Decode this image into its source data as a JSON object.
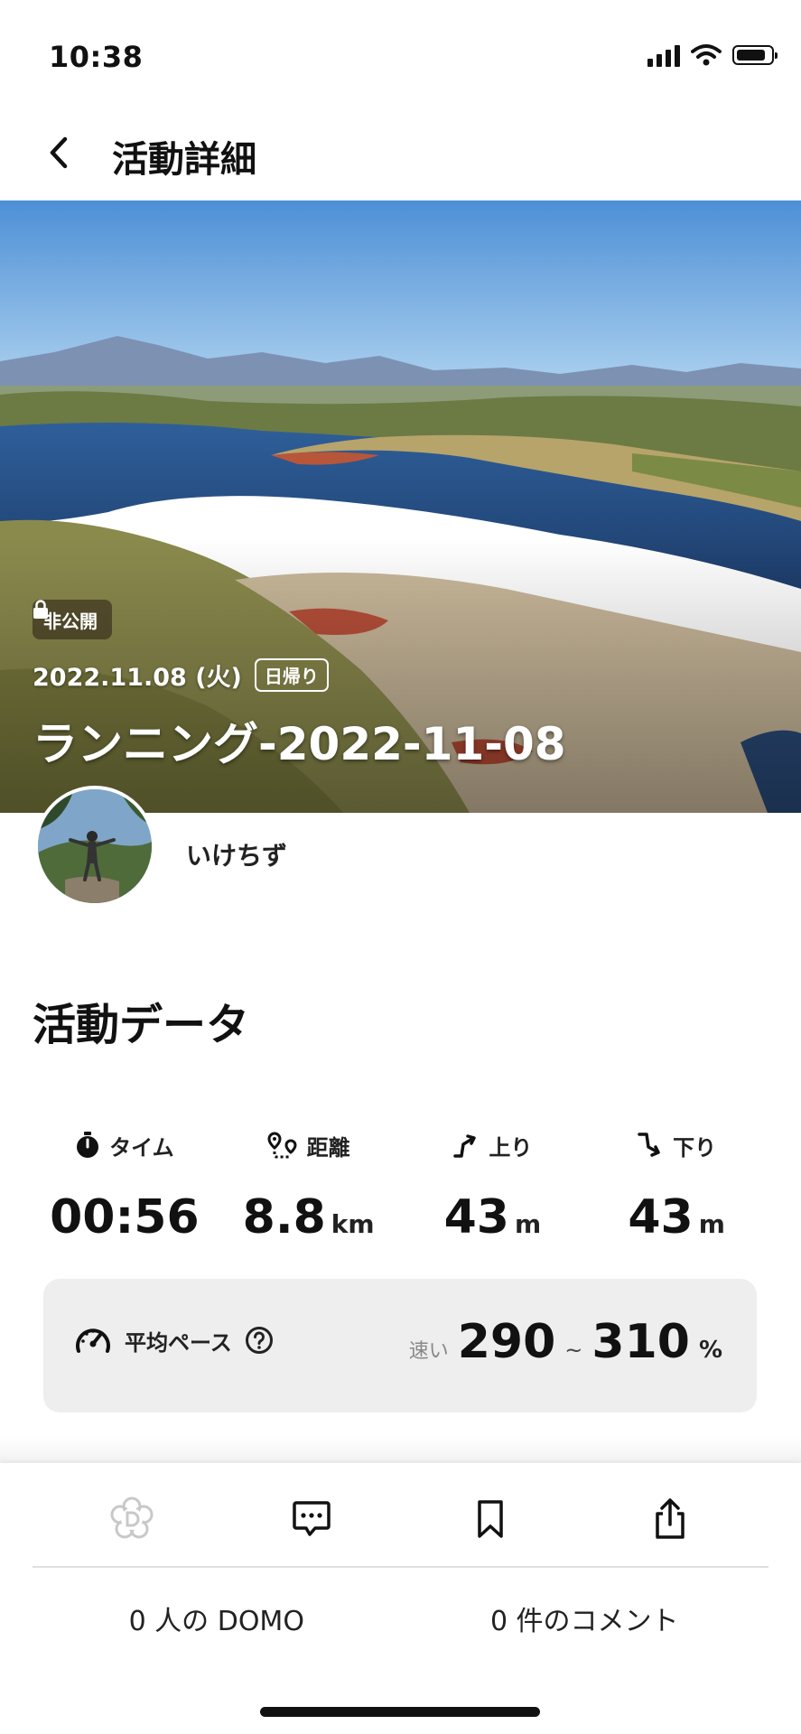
{
  "status_bar": {
    "time": "10:38",
    "icons": [
      "signal-icon",
      "wifi-icon",
      "battery-icon"
    ]
  },
  "nav": {
    "back_icon": "chevron-left-icon",
    "title": "活動詳細"
  },
  "hero": {
    "privacy_label": "非公開",
    "privacy_icon": "lock-icon",
    "date": "2022.11.08 (火)",
    "trip_type": "日帰り",
    "activity_title": "ランニング-2022-11-08"
  },
  "user": {
    "name": "いけちず"
  },
  "activity_data": {
    "section_title": "活動データ",
    "stats": [
      {
        "icon": "stopwatch-icon",
        "label": "タイム",
        "value": "00:56",
        "unit": ""
      },
      {
        "icon": "route-distance-icon",
        "label": "距離",
        "value": "8.8",
        "unit": "km"
      },
      {
        "icon": "ascent-icon",
        "label": "上り",
        "value": "43",
        "unit": "m"
      },
      {
        "icon": "descent-icon",
        "label": "下り",
        "value": "43",
        "unit": "m"
      }
    ],
    "pace": {
      "label": "平均ペース",
      "speed_label": "速い",
      "low": "290",
      "tilde": "~",
      "high": "310",
      "unit": "%"
    }
  },
  "actions": {
    "icons": [
      "domo-icon",
      "comment-icon",
      "bookmark-icon",
      "share-icon"
    ],
    "domo_count": "0 人の DOMO",
    "comment_count": "0 件のコメント"
  },
  "colors": {
    "text": "#111111",
    "pace_bg": "#eeeeee",
    "domo_disabled": "#c8c8c8"
  }
}
